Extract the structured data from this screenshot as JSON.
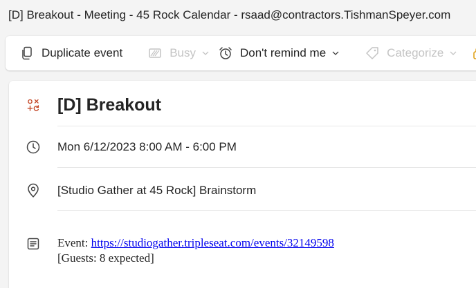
{
  "window": {
    "title": "[D] Breakout - Meeting - 45 Rock Calendar - rsaad@contractors.TishmanSpeyer.com"
  },
  "toolbar": {
    "duplicate_label": "Duplicate event",
    "busy_label": "Busy",
    "remind_label": "Don't remind me",
    "categorize_label": "Categorize"
  },
  "event": {
    "title": "[D] Breakout",
    "datetime": "Mon 6/12/2023 8:00 AM - 6:00 PM",
    "location": "[Studio Gather at 45 Rock] Brainstorm",
    "body_prefix": "Event: ",
    "body_link": "https://studiogather.tripleseat.com/events/32149598",
    "body_guests": "[Guests: 8 expected]"
  },
  "colors": {
    "accent_icon": "#c4492a",
    "disabled_text": "#c4c4c4",
    "link": "#0000ee"
  },
  "icons": {
    "duplicate": "duplicate-icon",
    "busy": "busy-status-icon",
    "remind": "alarm-clock-icon",
    "categorize": "tag-icon",
    "event_type": "event-type-icon",
    "time": "clock-icon",
    "location": "location-pin-icon",
    "body": "notes-icon"
  }
}
